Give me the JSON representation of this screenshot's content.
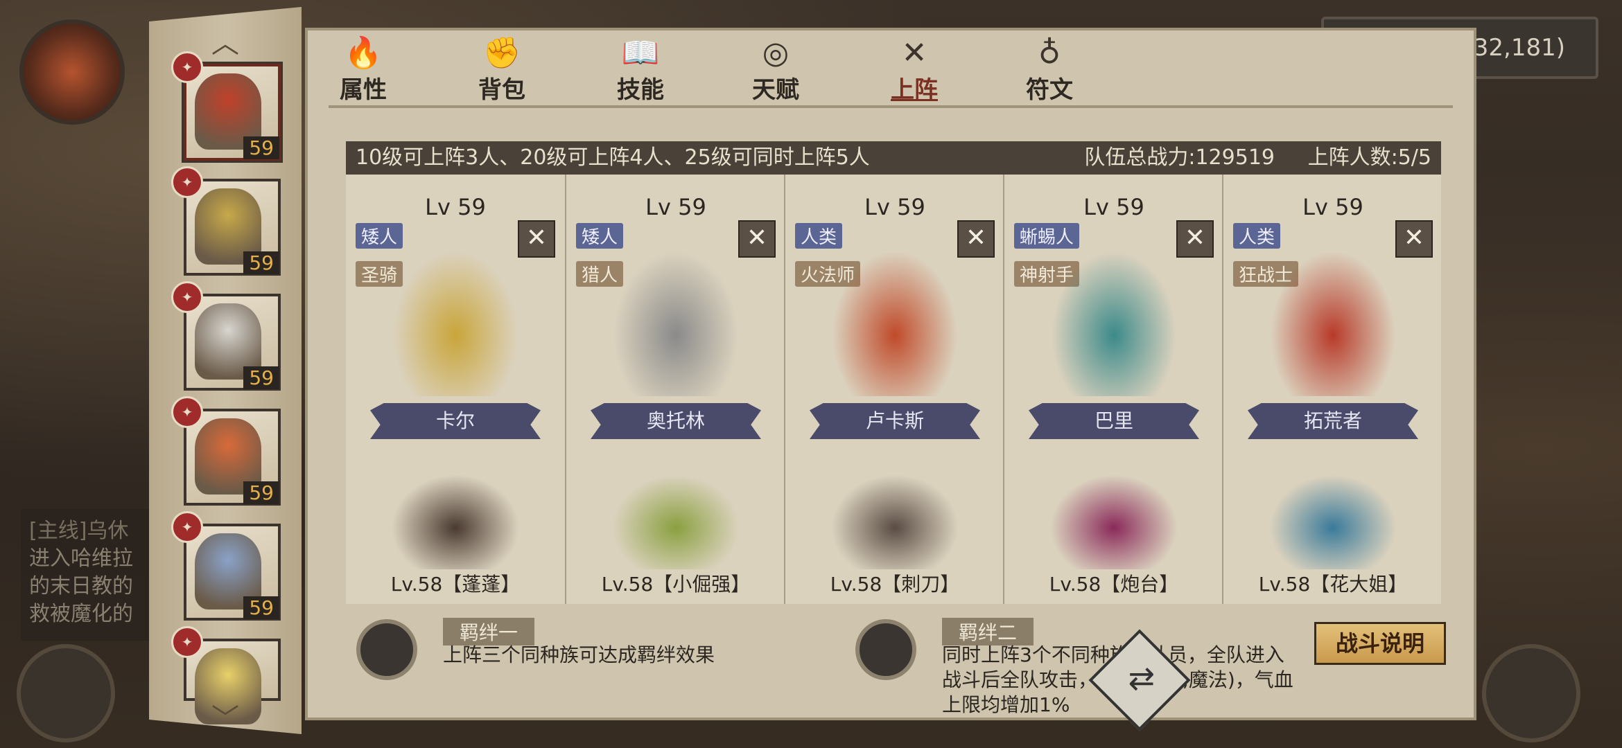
{
  "coords": "(32,181)",
  "quest": {
    "title": "[主线]乌休",
    "lines": [
      "进入哈维拉",
      "的末日教的",
      "救被魔化的"
    ]
  },
  "left_list": {
    "heroes": [
      {
        "level": "59",
        "color": "#c0412a"
      },
      {
        "level": "59",
        "color": "#c7a94a"
      },
      {
        "level": "59",
        "color": "#d8d6d0"
      },
      {
        "level": "59",
        "color": "#d86a3a"
      },
      {
        "level": "59",
        "color": "#8aa2c8"
      },
      {
        "level": "",
        "color": "#e8d06a"
      }
    ]
  },
  "tabs": [
    {
      "label": "属性",
      "icon": "🔥"
    },
    {
      "label": "背包",
      "icon": "✊"
    },
    {
      "label": "技能",
      "icon": "📖"
    },
    {
      "label": "天赋",
      "icon": "◎"
    },
    {
      "label": "上阵",
      "icon": "✕"
    },
    {
      "label": "符文",
      "icon": "♁"
    }
  ],
  "info": {
    "rule": "10级可上阵3人、20级可上阵4人、25级可同时上阵5人",
    "power": "队伍总战力:129519",
    "count": "上阵人数:5/5"
  },
  "slots": [
    {
      "lv": "Lv 59",
      "race": "矮人",
      "cls": "圣骑",
      "name": "卡尔",
      "pet": "Lv.58【蓬蓬】",
      "color": "#c9a53a",
      "petcolor": "#4a3a30"
    },
    {
      "lv": "Lv 59",
      "race": "矮人",
      "cls": "猎人",
      "name": "奥托林",
      "pet": "Lv.58【小倔强】",
      "color": "#8a8a8a",
      "petcolor": "#8aa040"
    },
    {
      "lv": "Lv 59",
      "race": "人类",
      "cls": "火法师",
      "name": "卢卡斯",
      "pet": "Lv.58【刺刀】",
      "color": "#c04a2a",
      "petcolor": "#5a4c44"
    },
    {
      "lv": "Lv 59",
      "race": "蜥蜴人",
      "cls": "神射手",
      "name": "巴里",
      "pet": "Lv.58【炮台】",
      "color": "#3c8a8a",
      "petcolor": "#8a2a5a"
    },
    {
      "lv": "Lv 59",
      "race": "人类",
      "cls": "狂战士",
      "name": "拓荒者",
      "pet": "Lv.58【花大姐】",
      "color": "#b83a2a",
      "petcolor": "#3a7a9a"
    }
  ],
  "close_symbol": "✕",
  "bond1": {
    "title": "羁绊一",
    "text": "上阵三个同种族可达成羁绊效果"
  },
  "bond2": {
    "title": "羁绊二",
    "lines": [
      "同时上阵3个不同种族的队员，全队进入",
      "战斗后全队攻击，防御(物理,魔法)，气血",
      "上限均增加1%"
    ]
  },
  "battle_button": "战斗说明",
  "swap_symbol": "⇄"
}
